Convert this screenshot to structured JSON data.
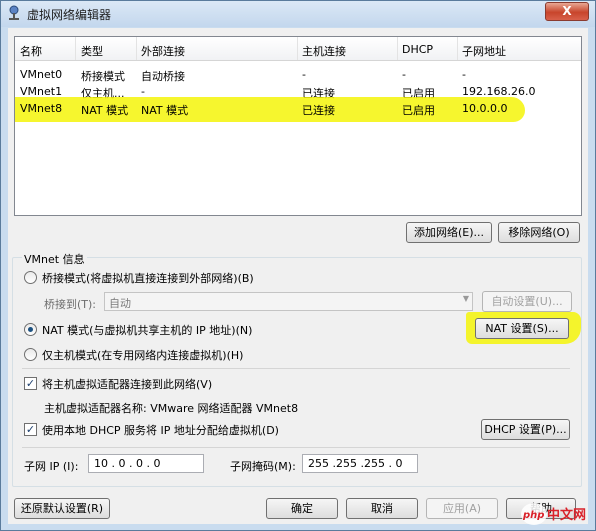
{
  "window": {
    "title": "虚拟网络编辑器",
    "close": "X"
  },
  "list": {
    "columns": [
      "名称",
      "类型",
      "外部连接",
      "主机连接",
      "DHCP",
      "子网地址"
    ],
    "rows": [
      {
        "name": "VMnet0",
        "type": "桥接模式",
        "external": "自动桥接",
        "host": "-",
        "dhcp": "-",
        "subnet": "-"
      },
      {
        "name": "VMnet1",
        "type": "仅主机...",
        "external": "-",
        "host": "已连接",
        "dhcp": "已启用",
        "subnet": "192.168.26.0"
      },
      {
        "name": "VMnet8",
        "type": "NAT 模式",
        "external": "NAT 模式",
        "host": "已连接",
        "dhcp": "已启用",
        "subnet": "10.0.0.0"
      }
    ],
    "selected_row": 2
  },
  "buttons": {
    "add_network": "添加网络(E)...",
    "remove_network": "移除网络(O)",
    "auto_settings": "自动设置(U)...",
    "nat_settings": "NAT 设置(S)...",
    "dhcp_settings": "DHCP 设置(P)...",
    "restore_defaults": "还原默认设置(R)",
    "ok": "确定",
    "cancel": "取消",
    "apply": "应用(A)",
    "help": "帮助"
  },
  "vmnet_info": {
    "group_title": "VMnet 信息",
    "bridged_label": "桥接模式(将虚拟机直接连接到外部网络)(B)",
    "bridged_to_label": "桥接到(T):",
    "bridged_to_value": "自动",
    "nat_label": "NAT 模式(与虚拟机共享主机的 IP 地址)(N)",
    "hostonly_label": "仅主机模式(在专用网络内连接虚拟机)(H)",
    "selected_mode": "nat",
    "connect_adapter_label": "将主机虚拟适配器连接到此网络(V)",
    "connect_adapter_checked": true,
    "adapter_name_label": "主机虚拟适配器名称: VMware 网络适配器 VMnet8",
    "use_dhcp_label": "使用本地 DHCP 服务将 IP 地址分配给虚拟机(D)",
    "use_dhcp_checked": true,
    "subnet_ip_label": "子网 IP (I):",
    "subnet_ip_value": "10 . 0 . 0 . 0",
    "subnet_mask_label": "子网掩码(M):",
    "subnet_mask_value": "255 .255 .255 . 0"
  },
  "watermark": {
    "text": "php中文网",
    "color": "#d9222a"
  },
  "colors": {
    "highlight": "#f4f400",
    "title_bar": "#c9dcef",
    "close_button": "#c8452b"
  }
}
